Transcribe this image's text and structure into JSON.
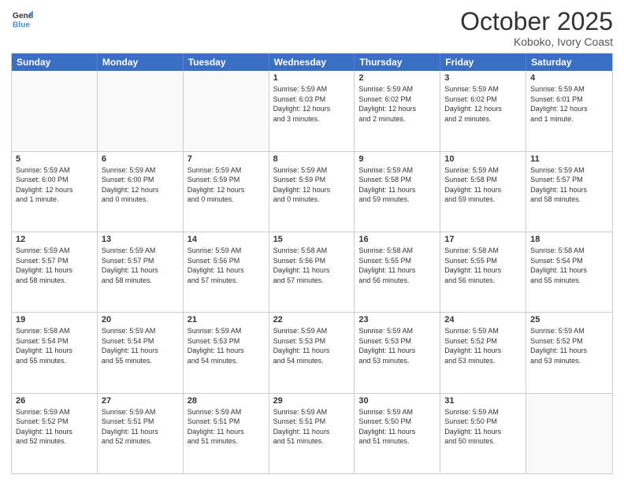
{
  "logo": {
    "line1": "General",
    "line2": "Blue"
  },
  "title": "October 2025",
  "location": "Koboko, Ivory Coast",
  "weekdays": [
    "Sunday",
    "Monday",
    "Tuesday",
    "Wednesday",
    "Thursday",
    "Friday",
    "Saturday"
  ],
  "rows": [
    [
      {
        "day": "",
        "text": "",
        "empty": true
      },
      {
        "day": "",
        "text": "",
        "empty": true
      },
      {
        "day": "",
        "text": "",
        "empty": true
      },
      {
        "day": "1",
        "text": "Sunrise: 5:59 AM\nSunset: 6:03 PM\nDaylight: 12 hours\nand 3 minutes.",
        "empty": false
      },
      {
        "day": "2",
        "text": "Sunrise: 5:59 AM\nSunset: 6:02 PM\nDaylight: 12 hours\nand 2 minutes.",
        "empty": false
      },
      {
        "day": "3",
        "text": "Sunrise: 5:59 AM\nSunset: 6:02 PM\nDaylight: 12 hours\nand 2 minutes.",
        "empty": false
      },
      {
        "day": "4",
        "text": "Sunrise: 5:59 AM\nSunset: 6:01 PM\nDaylight: 12 hours\nand 1 minute.",
        "empty": false
      }
    ],
    [
      {
        "day": "5",
        "text": "Sunrise: 5:59 AM\nSunset: 6:00 PM\nDaylight: 12 hours\nand 1 minute.",
        "empty": false
      },
      {
        "day": "6",
        "text": "Sunrise: 5:59 AM\nSunset: 6:00 PM\nDaylight: 12 hours\nand 0 minutes.",
        "empty": false
      },
      {
        "day": "7",
        "text": "Sunrise: 5:59 AM\nSunset: 5:59 PM\nDaylight: 12 hours\nand 0 minutes.",
        "empty": false
      },
      {
        "day": "8",
        "text": "Sunrise: 5:59 AM\nSunset: 5:59 PM\nDaylight: 12 hours\nand 0 minutes.",
        "empty": false
      },
      {
        "day": "9",
        "text": "Sunrise: 5:59 AM\nSunset: 5:58 PM\nDaylight: 11 hours\nand 59 minutes.",
        "empty": false
      },
      {
        "day": "10",
        "text": "Sunrise: 5:59 AM\nSunset: 5:58 PM\nDaylight: 11 hours\nand 59 minutes.",
        "empty": false
      },
      {
        "day": "11",
        "text": "Sunrise: 5:59 AM\nSunset: 5:57 PM\nDaylight: 11 hours\nand 58 minutes.",
        "empty": false
      }
    ],
    [
      {
        "day": "12",
        "text": "Sunrise: 5:59 AM\nSunset: 5:57 PM\nDaylight: 11 hours\nand 58 minutes.",
        "empty": false
      },
      {
        "day": "13",
        "text": "Sunrise: 5:59 AM\nSunset: 5:57 PM\nDaylight: 11 hours\nand 58 minutes.",
        "empty": false
      },
      {
        "day": "14",
        "text": "Sunrise: 5:59 AM\nSunset: 5:56 PM\nDaylight: 11 hours\nand 57 minutes.",
        "empty": false
      },
      {
        "day": "15",
        "text": "Sunrise: 5:58 AM\nSunset: 5:56 PM\nDaylight: 11 hours\nand 57 minutes.",
        "empty": false
      },
      {
        "day": "16",
        "text": "Sunrise: 5:58 AM\nSunset: 5:55 PM\nDaylight: 11 hours\nand 56 minutes.",
        "empty": false
      },
      {
        "day": "17",
        "text": "Sunrise: 5:58 AM\nSunset: 5:55 PM\nDaylight: 11 hours\nand 56 minutes.",
        "empty": false
      },
      {
        "day": "18",
        "text": "Sunrise: 5:58 AM\nSunset: 5:54 PM\nDaylight: 11 hours\nand 55 minutes.",
        "empty": false
      }
    ],
    [
      {
        "day": "19",
        "text": "Sunrise: 5:58 AM\nSunset: 5:54 PM\nDaylight: 11 hours\nand 55 minutes.",
        "empty": false
      },
      {
        "day": "20",
        "text": "Sunrise: 5:59 AM\nSunset: 5:54 PM\nDaylight: 11 hours\nand 55 minutes.",
        "empty": false
      },
      {
        "day": "21",
        "text": "Sunrise: 5:59 AM\nSunset: 5:53 PM\nDaylight: 11 hours\nand 54 minutes.",
        "empty": false
      },
      {
        "day": "22",
        "text": "Sunrise: 5:59 AM\nSunset: 5:53 PM\nDaylight: 11 hours\nand 54 minutes.",
        "empty": false
      },
      {
        "day": "23",
        "text": "Sunrise: 5:59 AM\nSunset: 5:53 PM\nDaylight: 11 hours\nand 53 minutes.",
        "empty": false
      },
      {
        "day": "24",
        "text": "Sunrise: 5:59 AM\nSunset: 5:52 PM\nDaylight: 11 hours\nand 53 minutes.",
        "empty": false
      },
      {
        "day": "25",
        "text": "Sunrise: 5:59 AM\nSunset: 5:52 PM\nDaylight: 11 hours\nand 53 minutes.",
        "empty": false
      }
    ],
    [
      {
        "day": "26",
        "text": "Sunrise: 5:59 AM\nSunset: 5:52 PM\nDaylight: 11 hours\nand 52 minutes.",
        "empty": false
      },
      {
        "day": "27",
        "text": "Sunrise: 5:59 AM\nSunset: 5:51 PM\nDaylight: 11 hours\nand 52 minutes.",
        "empty": false
      },
      {
        "day": "28",
        "text": "Sunrise: 5:59 AM\nSunset: 5:51 PM\nDaylight: 11 hours\nand 51 minutes.",
        "empty": false
      },
      {
        "day": "29",
        "text": "Sunrise: 5:59 AM\nSunset: 5:51 PM\nDaylight: 11 hours\nand 51 minutes.",
        "empty": false
      },
      {
        "day": "30",
        "text": "Sunrise: 5:59 AM\nSunset: 5:50 PM\nDaylight: 11 hours\nand 51 minutes.",
        "empty": false
      },
      {
        "day": "31",
        "text": "Sunrise: 5:59 AM\nSunset: 5:50 PM\nDaylight: 11 hours\nand 50 minutes.",
        "empty": false
      },
      {
        "day": "",
        "text": "",
        "empty": true
      }
    ]
  ]
}
